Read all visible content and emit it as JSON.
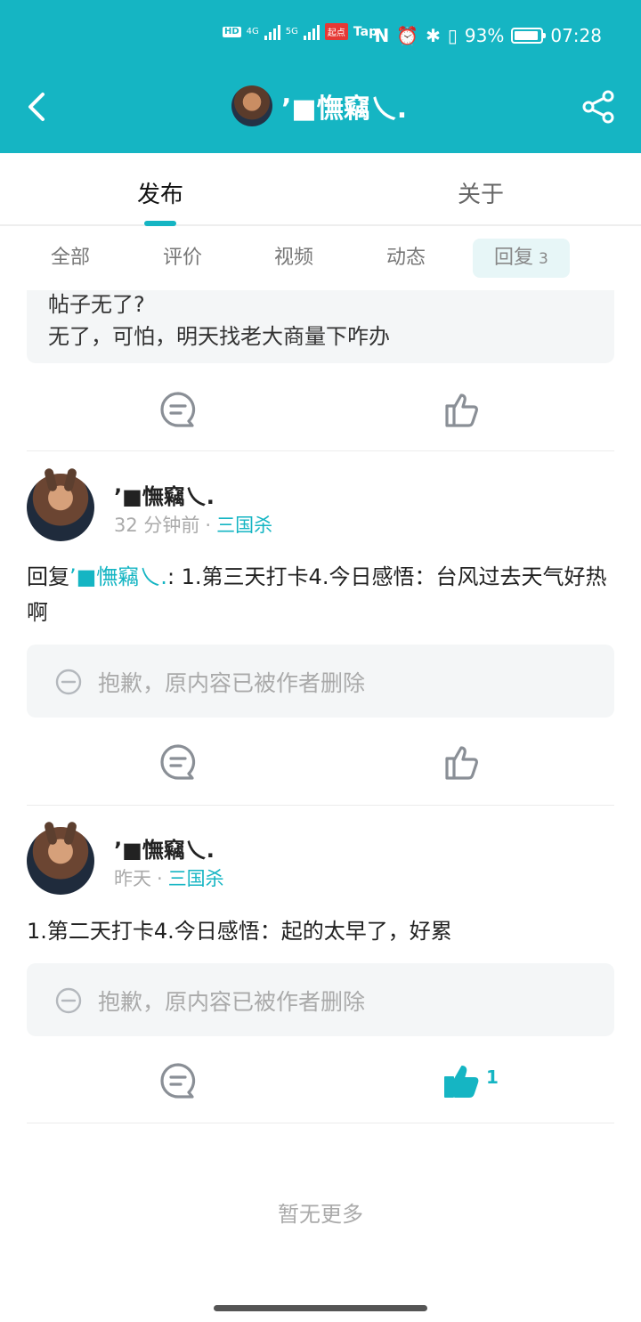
{
  "status_bar": {
    "network_left": "HD",
    "signal_1": "4G",
    "signal_2": "5G",
    "app_badge": "起点",
    "app_text": "Tap",
    "battery_percent": "93%",
    "battery_level": 0.93,
    "time": "07:28"
  },
  "header": {
    "title": "’■憮竊乀."
  },
  "tabs": [
    {
      "label": "发布",
      "active": true
    },
    {
      "label": "关于",
      "active": false
    }
  ],
  "filters": [
    {
      "label": "全部"
    },
    {
      "label": "评价"
    },
    {
      "label": "视频"
    },
    {
      "label": "动态"
    },
    {
      "label": "回复",
      "count": "3",
      "active": true
    }
  ],
  "top_quote": {
    "line1": "帖子无了?",
    "line2": "无了，可怕，明天找老大商量下咋办"
  },
  "posts": [
    {
      "username": "’■憮竊乀.",
      "time": "32 分钟前",
      "dot": "·",
      "game": "三国杀",
      "reply_prefix": "回复",
      "mention": "’■憮竊乀.",
      "text": ": 1.第三天打卡4.今日感悟：台风过去天气好热啊",
      "deleted_notice": "抱歉，原内容已被作者删除"
    },
    {
      "username": "’■憮竊乀.",
      "time": "昨天",
      "dot": "·",
      "game": "三国杀",
      "text": "1.第二天打卡4.今日感悟：起的太早了，好累",
      "deleted_notice": "抱歉，原内容已被作者删除",
      "like_count": "1"
    }
  ],
  "footer": {
    "no_more": "暂无更多"
  }
}
